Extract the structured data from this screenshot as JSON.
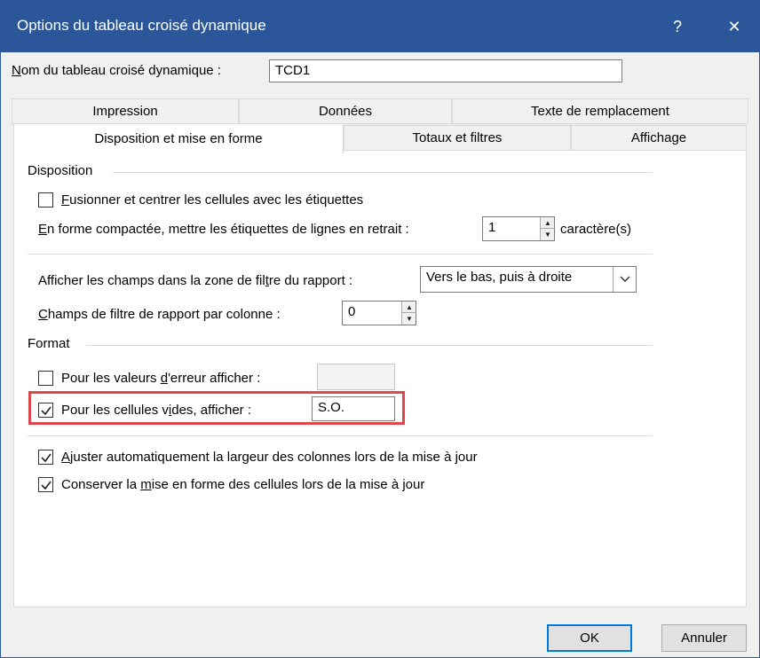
{
  "window": {
    "title": "Options du tableau croisé dynamique",
    "help_glyph": "?",
    "close_glyph": "✕"
  },
  "name_field": {
    "label_underlined": "N",
    "label_rest": "om du tableau croisé dynamique :",
    "value": "TCD1"
  },
  "tabs": {
    "row1": [
      "Impression",
      "Données",
      "Texte de remplacement"
    ],
    "row2": [
      "Disposition et mise en forme",
      "Totaux et filtres",
      "Affichage"
    ],
    "active": "Disposition et mise en forme"
  },
  "disposition": {
    "group_title": "Disposition",
    "merge_cells": {
      "checked": false,
      "label_underlined": "F",
      "label_rest": "usionner et centrer les cellules avec les étiquettes"
    },
    "indent": {
      "label_underlined": "E",
      "label_rest": "n forme compactée, mettre les étiquettes de lignes en retrait :",
      "value": "1",
      "unit": "caractère(s)"
    },
    "filter_area": {
      "label_before": "Afficher les champs dans la zone de fil",
      "label_underlined": "t",
      "label_after": "re du rapport :",
      "value": "Vers le bas, puis à droite"
    },
    "filter_per_column": {
      "label_underlined": "C",
      "label_rest": "hamps de filtre de rapport par colonne :",
      "value": "0"
    }
  },
  "format": {
    "group_title": "Format",
    "error_values": {
      "checked": false,
      "label_before": "Pour les valeurs ",
      "label_underlined": "d",
      "label_after": "'erreur afficher :",
      "value": ""
    },
    "empty_cells": {
      "checked": true,
      "label_before": "Pour les cellules v",
      "label_underlined": "i",
      "label_after": "des, afficher :",
      "value": "S.O."
    },
    "autofit": {
      "checked": true,
      "label_underlined": "A",
      "label_rest": "juster automatiquement la largeur des colonnes lors de la mise à jour"
    },
    "preserve": {
      "checked": true,
      "label_before": "Conserver la ",
      "label_underlined": "m",
      "label_after": "ise en forme des cellules lors de la mise à jour"
    }
  },
  "buttons": {
    "ok": "OK",
    "cancel": "Annuler"
  },
  "colors": {
    "titlebar": "#2b579a",
    "highlight": "#e0474c",
    "default_button_border": "#0078d7"
  }
}
